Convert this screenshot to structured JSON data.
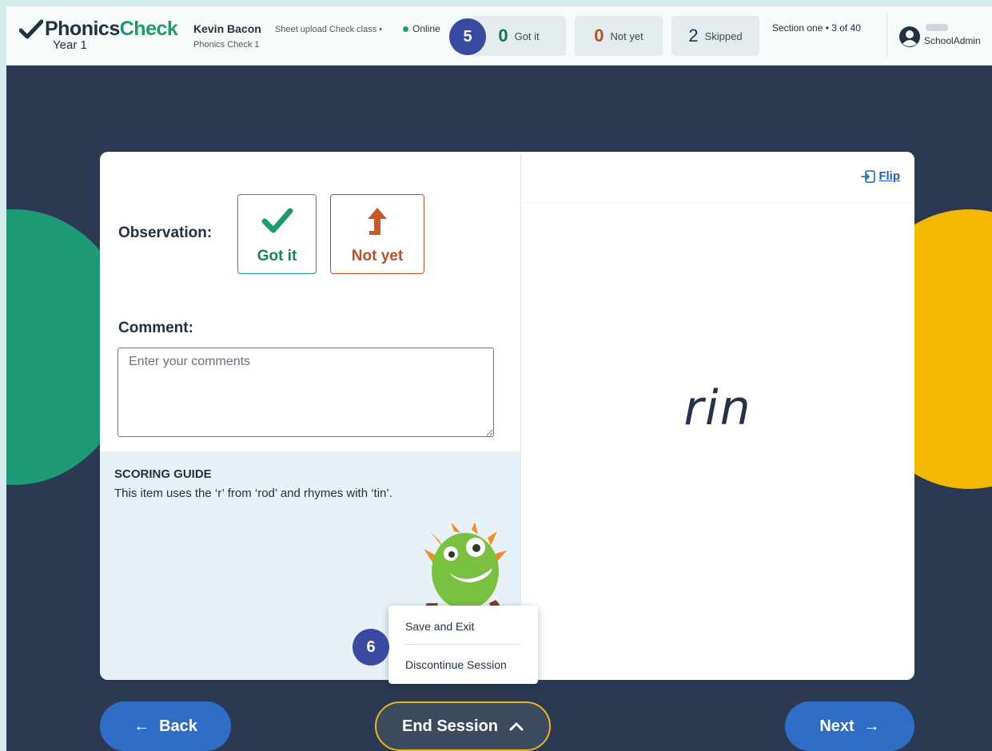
{
  "header": {
    "logo": {
      "brand_dark": "Phonics",
      "brand_green": "Check",
      "subtitle": "Year 1"
    },
    "student_name": "Kevin Bacon",
    "class_name": "Sheet upload Check class •",
    "check_name": "Phonics Check 1",
    "status": "Online",
    "stats": {
      "got_it": {
        "count": "0",
        "label": "Got it"
      },
      "not_yet": {
        "count": "0",
        "label": "Not yet"
      },
      "skipped": {
        "count": "2",
        "label": "Skipped"
      }
    },
    "section": "Section one • 3 of 40",
    "user": {
      "role": "SchoolAdmin",
      "icon": "user-circle-icon"
    }
  },
  "card": {
    "observation_label": "Observation:",
    "got_it_label": "Got it",
    "not_yet_label": "Not yet",
    "comment_label": "Comment:",
    "comment_placeholder": "Enter your comments",
    "comment_value": "",
    "scoring_guide": {
      "title": "SCORING GUIDE",
      "text": "This item uses the ‘r’ from ‘rod’ and rhymes with ‘tin’."
    },
    "flip_label": "Flip",
    "word": "rin"
  },
  "session_menu": {
    "items": [
      {
        "label": "Save and Exit"
      },
      {
        "label": "Discontinue Session"
      }
    ]
  },
  "footer": {
    "back_label": "Back",
    "end_session_label": "End Session",
    "next_label": "Next"
  },
  "annotations": {
    "badge_5": "5",
    "badge_6": "6"
  },
  "colors": {
    "brand_green": "#1f9a6e",
    "not_yet_orange": "#b65124",
    "primary_blue": "#2f6ec4",
    "background_navy": "#2b3a52",
    "accent_yellow": "#f3b800",
    "badge_indigo": "#3a4aa0"
  }
}
